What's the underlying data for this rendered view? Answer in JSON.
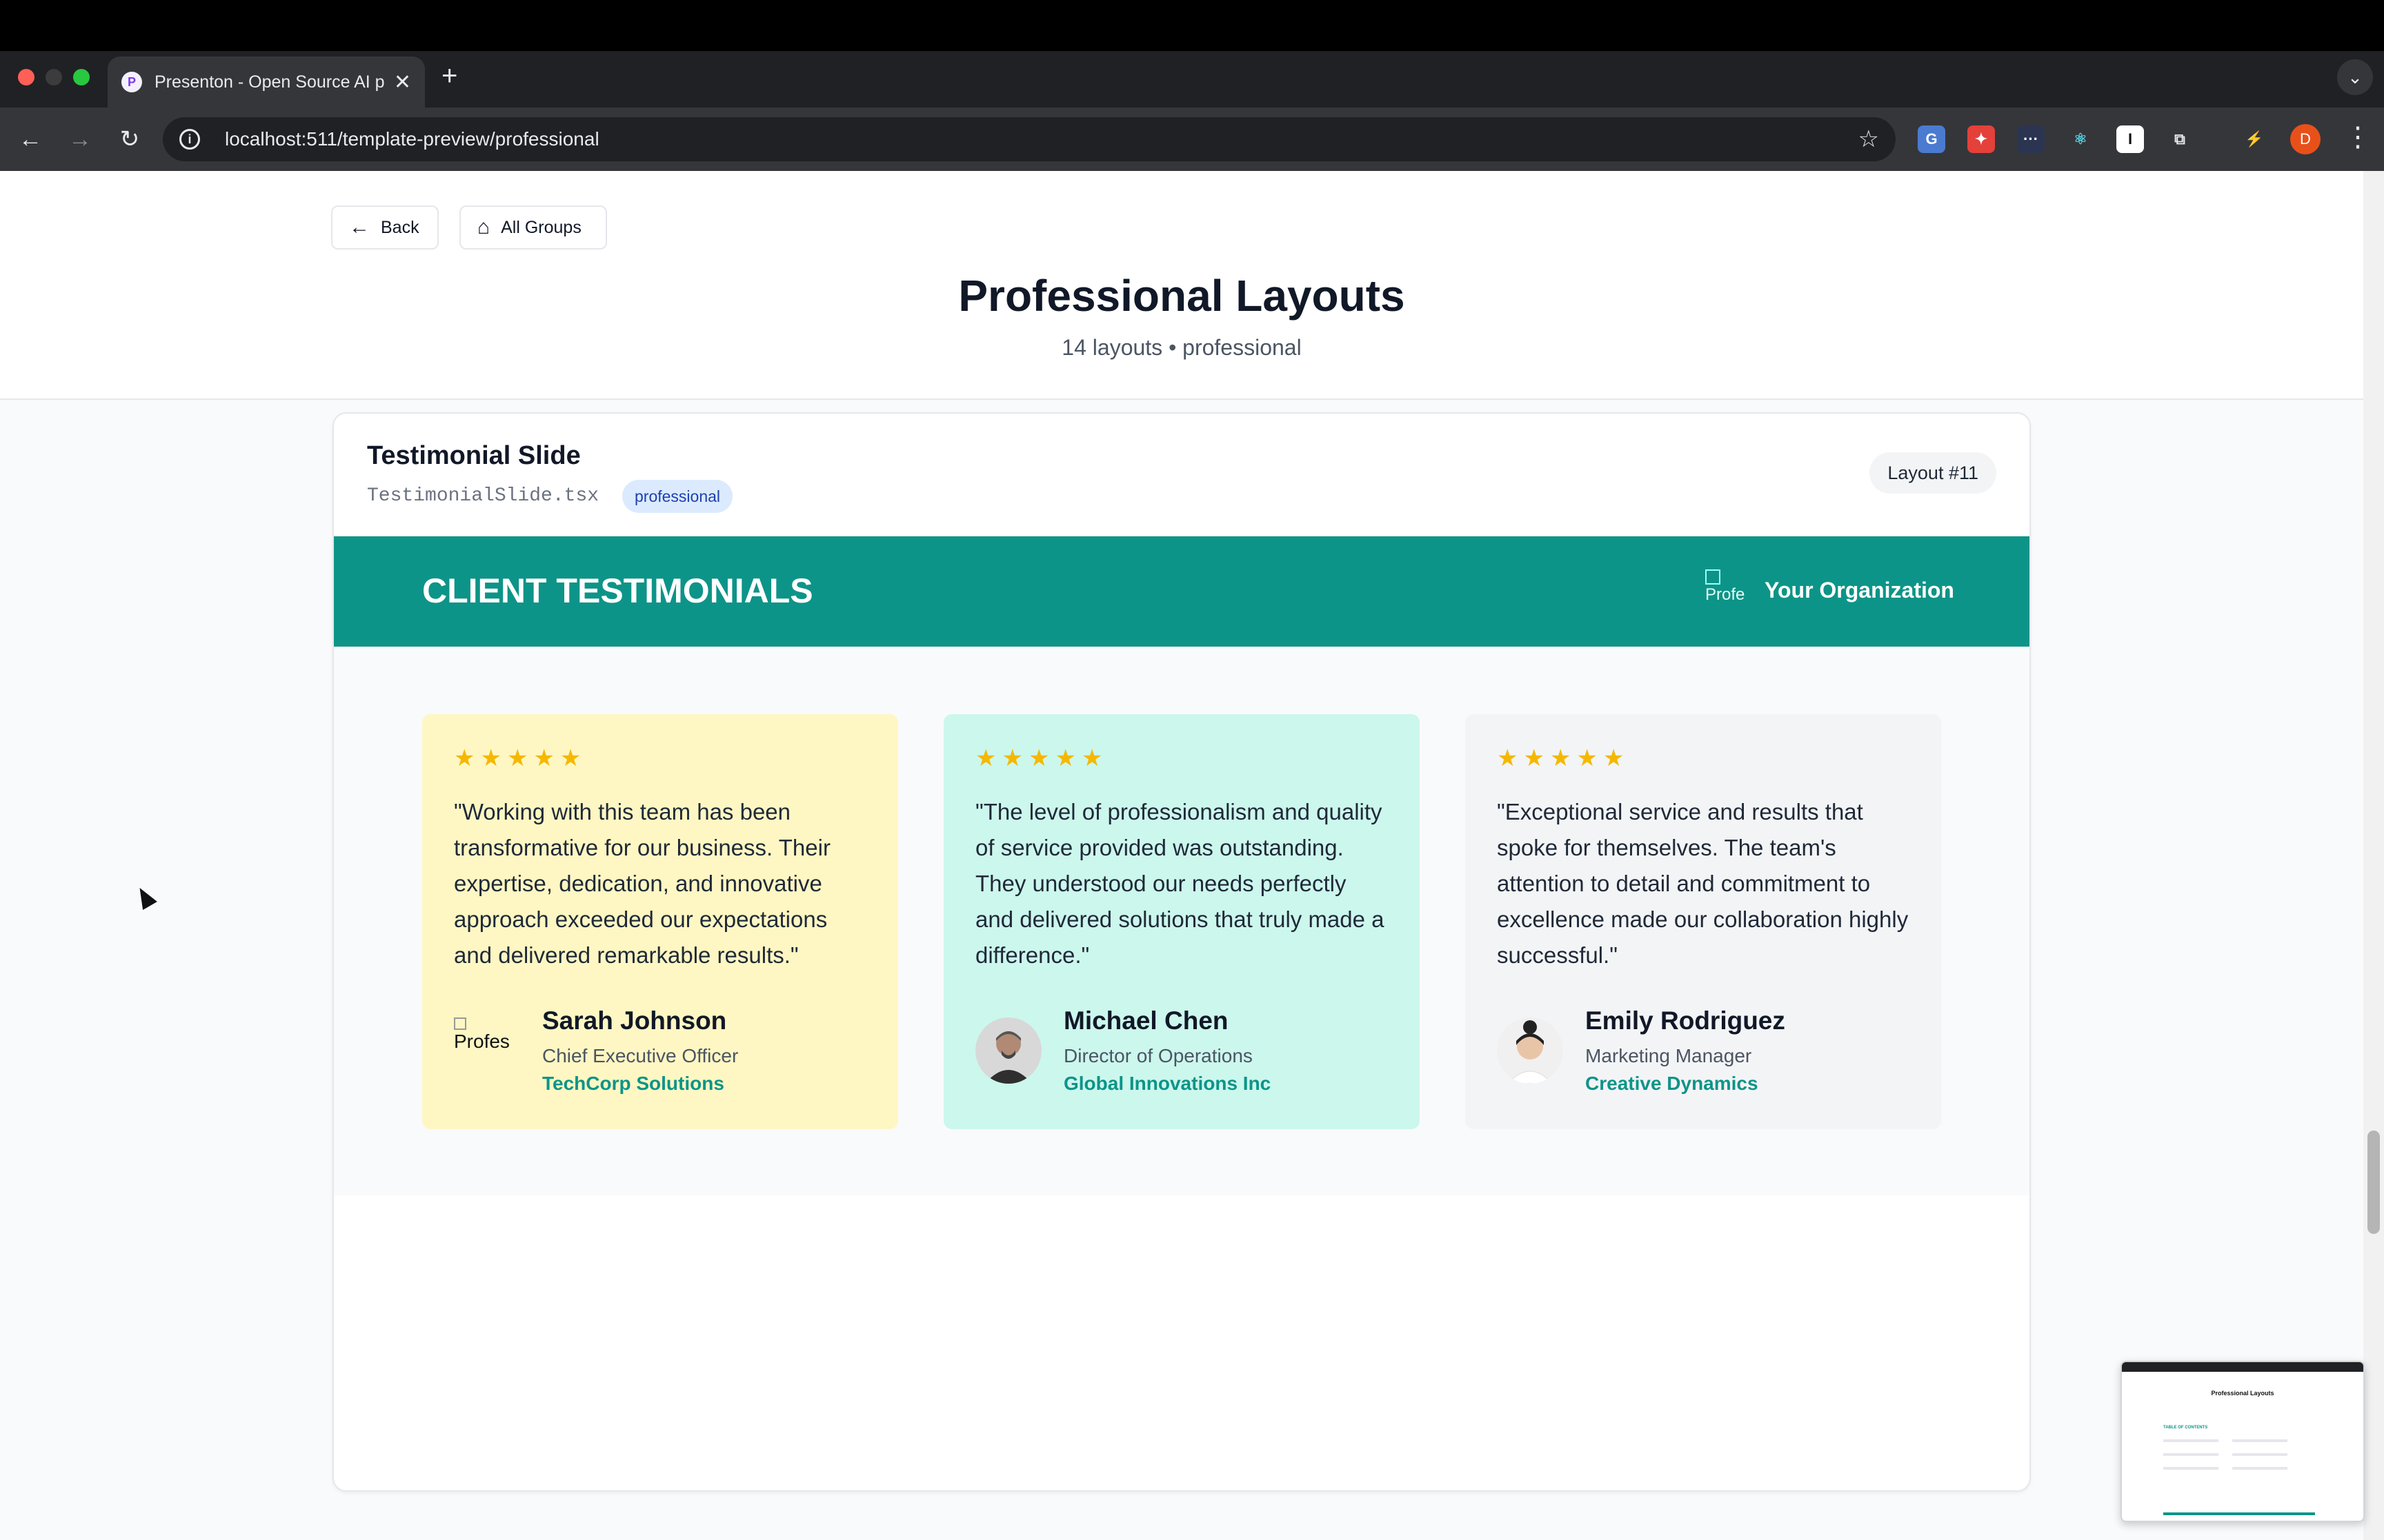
{
  "browser": {
    "tab_title": "Presenton - Open Source AI p",
    "tab_favicon": "P",
    "tab_close": "✕",
    "new_tab": "+",
    "url": "localhost:511/template-preview/professional",
    "profile_initial": "D"
  },
  "header": {
    "back_label": "Back",
    "all_groups_label": "All Groups",
    "title": "Professional Layouts",
    "subtitle": "14 layouts • professional"
  },
  "layout_card": {
    "title": "Testimonial Slide",
    "file": "TestimonialSlide.tsx",
    "tag": "professional",
    "layout_number": "Layout #11"
  },
  "slide": {
    "heading": "CLIENT TESTIMONIALS",
    "org_logo_alt": "Profe",
    "org_name": "Your Organization",
    "accent_color": "#0d9488",
    "testimonials": [
      {
        "stars": "★★★★★",
        "rating": 5,
        "quote": "\"Working with this team has been transformative for our business. Their expertise, dedication, and innovative approach exceeded our expectations and delivered remarkable results.\"",
        "name": "Sarah Johnson",
        "role": "Chief Executive Officer",
        "company": "TechCorp Solutions",
        "avatar_alt": "Profes",
        "background": "#fef7c3"
      },
      {
        "stars": "★★★★★",
        "rating": 5,
        "quote": "\"The level of professionalism and quality of service provided was outstanding. They understood our needs perfectly and delivered solutions that truly made a difference.\"",
        "name": "Michael Chen",
        "role": "Director of Operations",
        "company": "Global Innovations Inc",
        "background": "#ccf7ed"
      },
      {
        "stars": "★★★★★",
        "rating": 5,
        "quote": "\"Exceptional service and results that spoke for themselves. The team's attention to detail and commitment to excellence made our collaboration highly successful.\"",
        "name": "Emily Rodriguez",
        "role": "Marketing Manager",
        "company": "Creative Dynamics",
        "background": "#f3f4f6"
      }
    ]
  },
  "thumbnail": {
    "title": "Professional Layouts",
    "section_label": "TABLE OF CONTENTS"
  }
}
